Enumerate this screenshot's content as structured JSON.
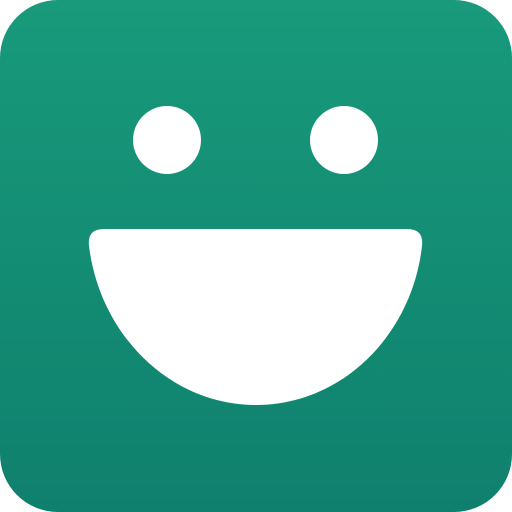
{
  "icon": {
    "name": "smiling-face-icon",
    "colors": {
      "background_top": "#189A7B",
      "background_bottom": "#0F806D",
      "face": "#FFFFFF"
    }
  }
}
